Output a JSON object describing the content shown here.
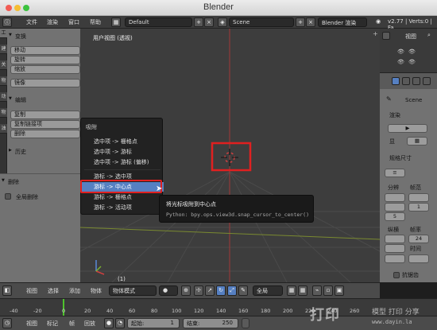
{
  "window": {
    "title": "Blender"
  },
  "topbar": {
    "menu": [
      "文件",
      "渲染",
      "窗口",
      "帮助"
    ],
    "layout": "Default",
    "scene": "Scene",
    "engine": "Blender 渲染",
    "info": "v2.77 | Verts:0 | Fa"
  },
  "tool_tabs": [
    "工",
    "建",
    "关",
    "物",
    "动",
    "物",
    "油"
  ],
  "toolshelf": {
    "transform_header": "变换",
    "transform_buttons": [
      "移动",
      "旋转",
      "缩放"
    ],
    "mirror_button": "镜像",
    "edit_header": "编辑",
    "edit_buttons": [
      "复制",
      "复制链接项",
      "删除"
    ],
    "history_header": "历史",
    "delete_header": "删除",
    "global_delete_label": "全局删除"
  },
  "viewport": {
    "title": "用户视图 (透视)",
    "frame": "(1)"
  },
  "snap_menu": {
    "title": "吸附",
    "items": [
      "选中项 -> 栅格点",
      "选中项 -> 游标",
      "选中项 -> 游标 (偏移)",
      "游标 -> 选中项",
      "游标 -> 中心点",
      "游标 -> 栅格点",
      "游标 -> 活动项"
    ],
    "active_index": 4
  },
  "tooltip": {
    "title": "将光标吸附到中心点",
    "python": "Python: bpy.ops.view3d.snap_cursor_to_center()"
  },
  "right_panel": {
    "outliner_tab": "视图",
    "scene_label": "Scene",
    "render_header": "渲染",
    "display_label": "显",
    "dimensions_header": "规格尺寸",
    "resolution_label": "分辨",
    "frame_rate_label": "帧范",
    "field_1": "1",
    "field_5": "5",
    "aspect_label": "纵横",
    "fps_label": "帧率",
    "fps_value": "24",
    "time_label": "时间",
    "anti_alias_label": "抗锯齿"
  },
  "header3d": {
    "menus": [
      "视图",
      "选择",
      "添加",
      "物体"
    ],
    "mode": "物体模式",
    "pivot": "全局"
  },
  "timeline": {
    "ticks": [
      "-40",
      "-20",
      "0",
      "20",
      "40",
      "60",
      "80",
      "100",
      "120",
      "140",
      "160",
      "180",
      "200",
      "220",
      "240",
      "260"
    ]
  },
  "bottombar": {
    "menus": [
      "视图",
      "标记",
      "帧",
      "回放"
    ],
    "start_label": "起始:",
    "start_value": "1",
    "end_label": "结束:",
    "end_value": "250"
  },
  "watermark": {
    "big": "打印",
    "text": "模型 打印 分享",
    "url": "www.dayin.la"
  },
  "colors": {
    "accent": "#5680c2",
    "highlight_box": "#e02020",
    "frame_marker": "#4ec32c"
  }
}
